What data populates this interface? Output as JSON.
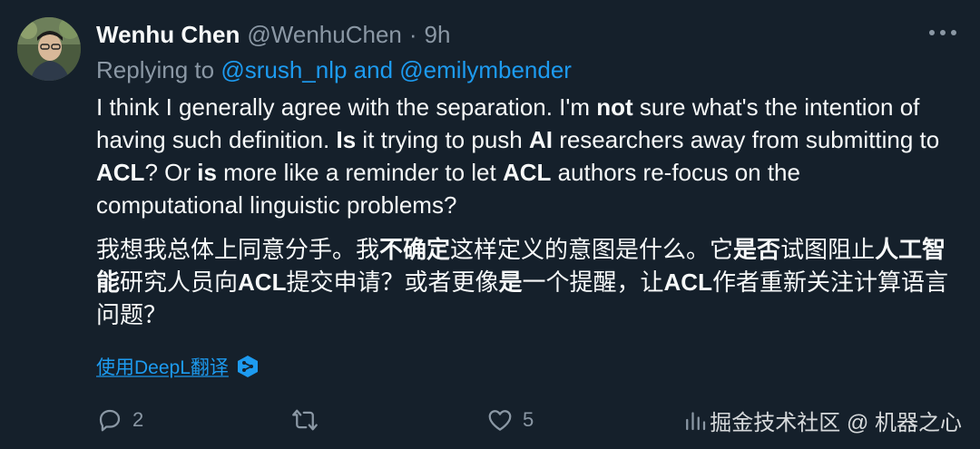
{
  "author": {
    "name": "Wenhu Chen",
    "handle": "@WenhuChen",
    "separator": "·",
    "time": "9h"
  },
  "reply": {
    "prefix": "Replying to ",
    "mention1": "@srush_nlp",
    "and": " and ",
    "mention2": "@emilymbender"
  },
  "body_en": {
    "s1": "I think I generally agree with the separation. I'm ",
    "b1": "not",
    "s2": " sure what's the intention of having such definition. ",
    "b2": "Is",
    "s3": " it trying to push ",
    "b3": "AI",
    "s4": " researchers away from submitting to ",
    "b4": "ACL",
    "s5": "? Or ",
    "b5": "is",
    "s6": " more like a reminder to let ",
    "b6": "ACL",
    "s7": " authors re-focus on the computational linguistic problems?"
  },
  "body_zh": {
    "s1": "我想我总体上同意分手。我",
    "b1": "不确定",
    "s2": "这样定义的意图是什么。它",
    "b2": "是否",
    "s3": "试图阻止",
    "b3": "人工智能",
    "s4": "研究人员向",
    "b4": "ACL",
    "s5": "提交申请？或者更像",
    "b5": "是",
    "s6": "一个提醒，让",
    "b6": "ACL",
    "s7": "作者重新关注计算语言问题？"
  },
  "translate": {
    "label": "使用DeepL翻译",
    "icon": "deepl-icon"
  },
  "actions": {
    "reply_count": "2",
    "retweet_count": "",
    "like_count": "5"
  },
  "watermark": "掘金技术社区 @ 机器之心",
  "colors": {
    "background": "#15202b",
    "text": "#f7f9f9",
    "secondary": "#8b98a5",
    "link": "#1d9bf0"
  }
}
